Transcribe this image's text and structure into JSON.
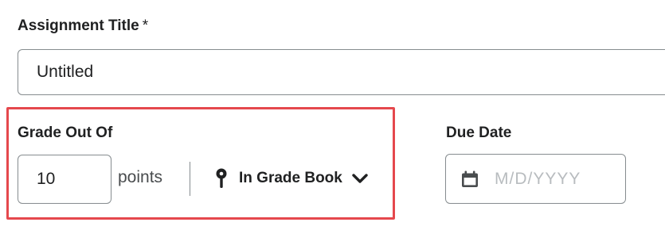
{
  "assignment_title": {
    "label": "Assignment Title",
    "required_marker": "*",
    "value": "Untitled"
  },
  "grade": {
    "label": "Grade Out Of",
    "value": "10",
    "unit": "points",
    "gradebook_label": "In Grade Book",
    "gradebook_icon": "pin-icon",
    "dropdown_icon": "chevron-down-icon"
  },
  "due_date": {
    "label": "Due Date",
    "placeholder": "M/D/YYYY",
    "icon": "calendar-icon"
  },
  "colors": {
    "highlight_border": "#e5484d",
    "input_border": "#868c8f",
    "text": "#202122",
    "placeholder": "#b8bcbf"
  }
}
